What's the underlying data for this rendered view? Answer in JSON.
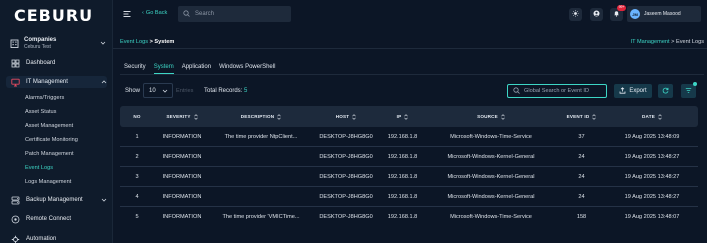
{
  "app": {
    "logo": "CEBURU"
  },
  "sidebar": {
    "company": {
      "title": "Companies",
      "subtitle": "Ceburu Test"
    },
    "items": [
      {
        "label": "Dashboard"
      },
      {
        "label": "IT Management"
      },
      {
        "label": "Backup Management"
      },
      {
        "label": "Remote Connect"
      },
      {
        "label": "Automation"
      }
    ],
    "it_sub": [
      {
        "label": "Alarms/Triggers"
      },
      {
        "label": "Asset Status"
      },
      {
        "label": "Asset Management"
      },
      {
        "label": "Certificate Monitoring"
      },
      {
        "label": "Patch Management"
      },
      {
        "label": "Event Logs"
      },
      {
        "label": "Logs Management"
      }
    ]
  },
  "header": {
    "go_back": "Go Back",
    "search_placeholder": "Search",
    "notification_count": "99+",
    "user_initials": "JM",
    "user_name": "Jaseem Masood"
  },
  "breadcrumb": {
    "parent": "Event Logs",
    "separator": ">",
    "current": "System",
    "right_parent": "IT Management",
    "right_current": "Event Logs"
  },
  "tabs": [
    "Security",
    "System",
    "Application",
    "Windows PowerShell"
  ],
  "toolbar": {
    "show_label": "Show",
    "entries_value": "10",
    "entries_label": "Entries",
    "total_label": "Total Records:",
    "total_value": "5",
    "global_search_placeholder": "Global Search or Event ID",
    "export_label": "Export"
  },
  "table": {
    "columns": [
      "NO",
      "SEVERITY",
      "DESCRIPTION",
      "HOST",
      "IP",
      "SOURCE",
      "EVENT ID",
      "DATE"
    ],
    "rows": [
      [
        "1",
        "INFORMATION",
        "The time provider NtpClient...",
        "DESKTOP-J8HG8G0",
        "192.168.1.8",
        "Microsoft-Windows-Time-Service",
        "37",
        "19 Aug 2025 13:48:09"
      ],
      [
        "2",
        "INFORMATION",
        "",
        "DESKTOP-J8HG8G0",
        "192.168.1.8",
        "Microsoft-Windows-Kernel-General",
        "24",
        "19 Aug 2025 13:48:27"
      ],
      [
        "3",
        "INFORMATION",
        "",
        "DESKTOP-J8HG8G0",
        "192.168.1.8",
        "Microsoft-Windows-Kernel-General",
        "24",
        "19 Aug 2025 13:48:27"
      ],
      [
        "4",
        "INFORMATION",
        "",
        "DESKTOP-J8HG8G0",
        "192.168.1.8",
        "Microsoft-Windows-Kernel-General",
        "24",
        "19 Aug 2025 13:48:27"
      ],
      [
        "5",
        "INFORMATION",
        "The time provider 'VMICTime...",
        "DESKTOP-J8HG8G0",
        "192.168.1.8",
        "Microsoft-Windows-Time-Service",
        "158",
        "19 Aug 2025 13:48:07"
      ]
    ]
  },
  "colors": {
    "accent": "#3dd6c6",
    "background": "#0c1626",
    "sidebar": "#0f1b2b",
    "header_row": "#1d2a3c",
    "badge": "#e0243a"
  },
  "icons": [
    "building-icon",
    "dashboard-icon",
    "monitor-icon",
    "backup-icon",
    "remote-icon",
    "automation-icon",
    "hamburger-icon",
    "search-icon",
    "sun-icon",
    "user-circle-icon",
    "bell-icon",
    "export-icon",
    "refresh-icon",
    "filter-icon",
    "sort-icon",
    "chevron-down-icon"
  ]
}
